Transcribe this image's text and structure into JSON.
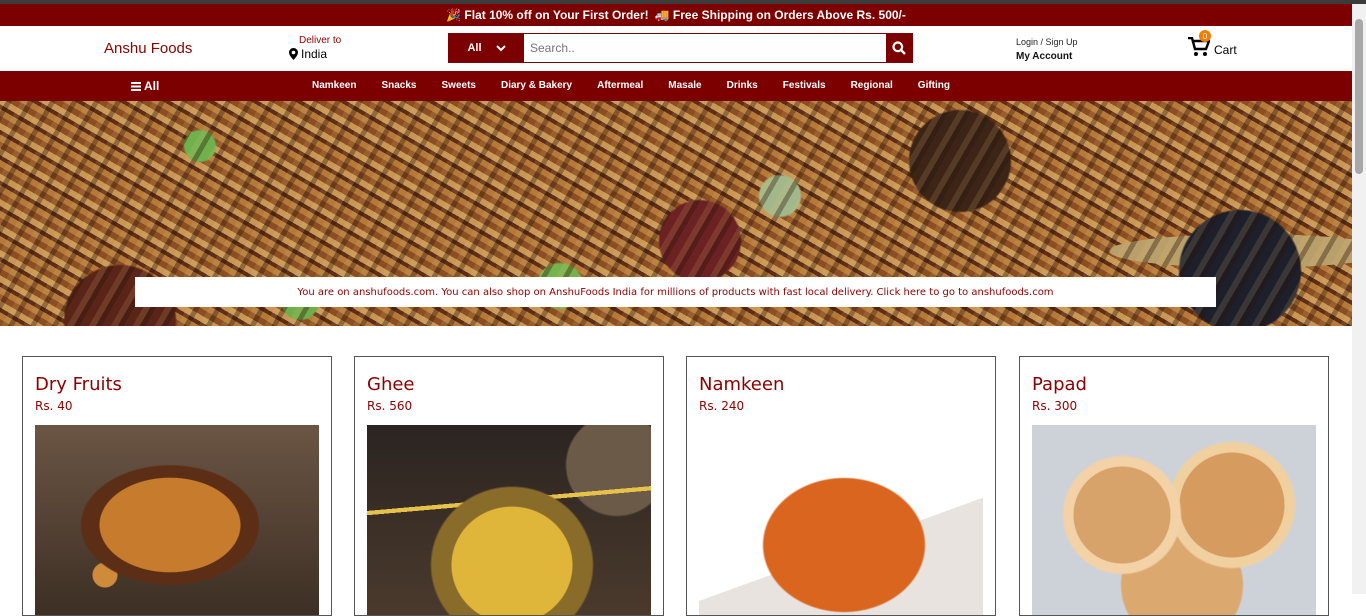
{
  "promo": {
    "text1": "🎉 Flat 10% off on Your First Order!",
    "text2": "🚚 Free Shipping on Orders Above Rs. 500/-"
  },
  "header": {
    "brand": "Anshu Foods",
    "deliver_label": "Deliver to",
    "deliver_value": "India",
    "search_category": "All",
    "search_placeholder": "Search..",
    "login_label": "Login / Sign Up",
    "account_label": "My Account",
    "cart_label": "Cart",
    "cart_count": "0"
  },
  "nav": {
    "all_label": "All",
    "items": [
      "Namkeen",
      "Snacks",
      "Sweets",
      "Diary & Bakery",
      "Aftermeal",
      "Masale",
      "Drinks",
      "Festivals",
      "Regional",
      "Gifting"
    ]
  },
  "hero": {
    "notice": "You are on anshufoods.com. You can also shop on AnshuFoods India for millions of products with fast local delivery. Click here to go to anshufoods.com"
  },
  "products": [
    {
      "name": "Dry Fruits",
      "price": "Rs. 40"
    },
    {
      "name": "Ghee",
      "price": "Rs. 560"
    },
    {
      "name": "Namkeen",
      "price": "Rs. 240"
    },
    {
      "name": "Papad",
      "price": "Rs. 300"
    }
  ],
  "colors": {
    "brand": "#7d0000",
    "accent": "#f57c00"
  }
}
